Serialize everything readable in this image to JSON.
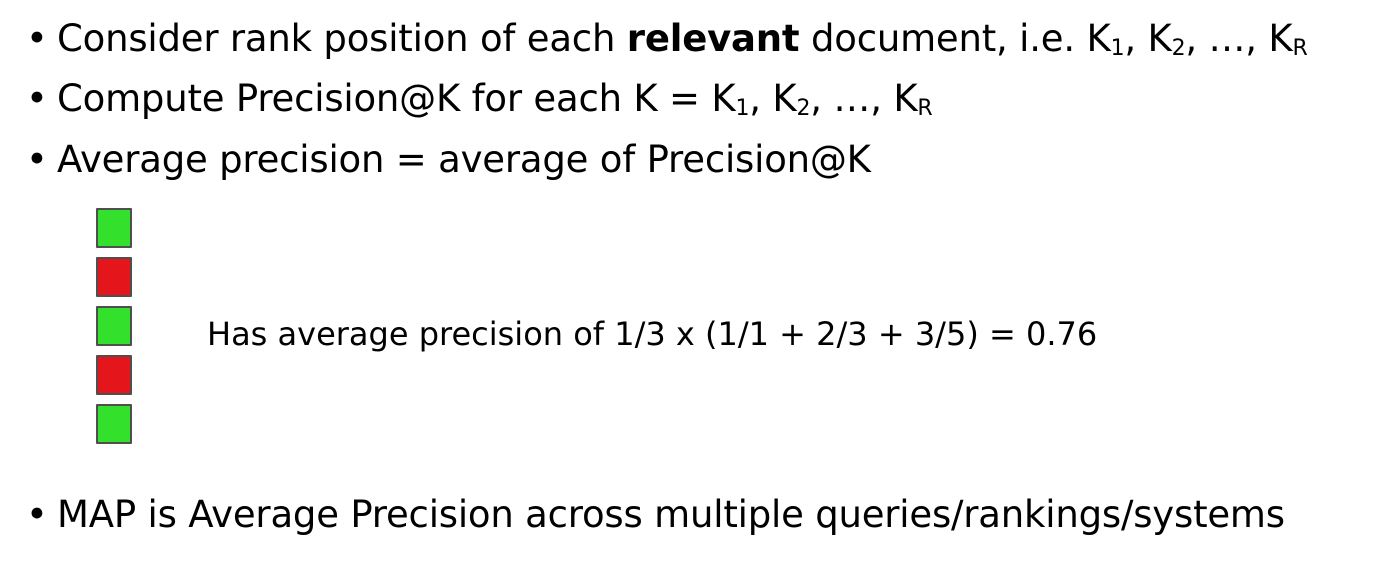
{
  "bullets": {
    "b1": {
      "marker": "•",
      "text_before": "Consider rank position of each ",
      "bold": "relevant",
      "text_after": " document, i.e. K",
      "sub1": "1",
      "sep1": ", K",
      "sub2": "2",
      "sep2": ", …, K",
      "subR": "R"
    },
    "b2": {
      "marker": "•",
      "text": "Compute Precision@K for each K = K",
      "sub1": "1",
      "sep1": ", K",
      "sub2": "2",
      "sep2": ", …, K",
      "subR": "R"
    },
    "b3": {
      "marker": "•",
      "text": "Average precision = average of Precision@K"
    },
    "b4": {
      "marker": "•",
      "text": "MAP is Average Precision across multiple queries/rankings/systems"
    }
  },
  "ranking": {
    "relevance": [
      true,
      false,
      true,
      false,
      true
    ],
    "relevant_color": "#33e02c",
    "nonrelevant_color": "#e4161b"
  },
  "caption": "Has average precision of 1/3 x (1/1 + 2/3 + 3/5) = 0.76"
}
